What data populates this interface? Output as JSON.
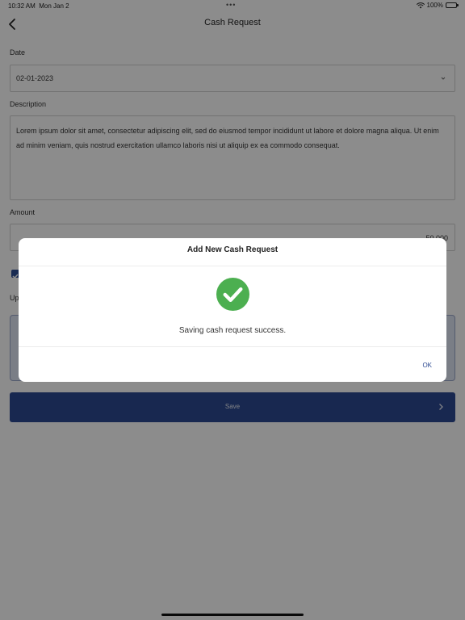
{
  "status_bar": {
    "time": "10:32 AM",
    "date": "Mon Jan 2",
    "battery": "100%"
  },
  "nav": {
    "title": "Cash Request"
  },
  "form": {
    "date_label": "Date",
    "date_value": "02-01-2023",
    "description_label": "Description",
    "description_value": "Lorem ipsum dolor sit amet, consectetur adipiscing elit, sed do eiusmod tempor incididunt ut labore et dolore magna aliqua. Ut enim ad minim veniam, quis nostrud exercitation ullamco laboris nisi ut aliquip ex ea commodo consequat.",
    "amount_label": "Amount",
    "amount_value": "50.000",
    "upload_label": "Up"
  },
  "save_button": {
    "label": "Save"
  },
  "dialog": {
    "title": "Add New Cash Request",
    "message": "Saving cash request success.",
    "ok_label": "OK"
  },
  "colors": {
    "primary": "#2d4a92",
    "success": "#4caf50",
    "overlay": "rgba(0,0,0,0.45)"
  },
  "icons": [
    "wifi-icon",
    "battery-icon",
    "back-chevron-icon",
    "chevron-down-icon",
    "checkbox-icon",
    "chevron-right-icon",
    "success-check-icon"
  ]
}
